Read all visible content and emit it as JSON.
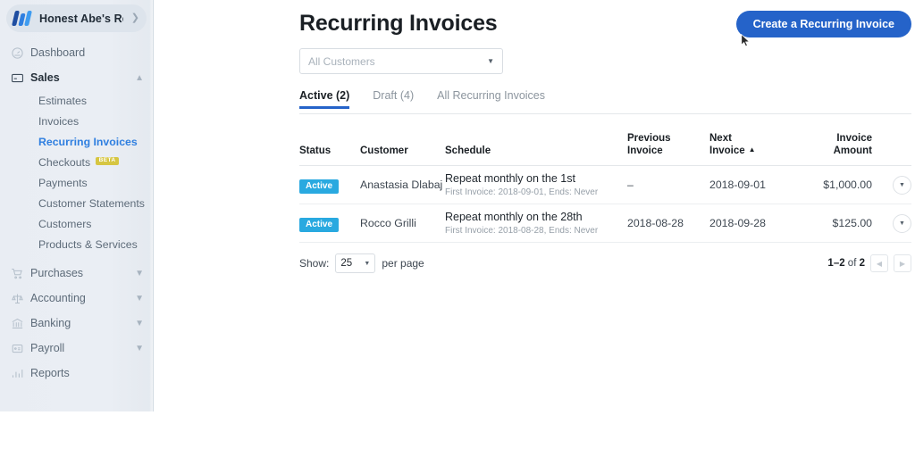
{
  "sidebar": {
    "business": {
      "name": "Honest Abe's Re…",
      "logo_icon": "wave-logo-icon",
      "chevron_icon": "chevron-right-icon"
    },
    "items": [
      {
        "label": "Dashboard",
        "icon": "gauge-icon",
        "expandable": false
      },
      {
        "label": "Sales",
        "icon": "credit-card-icon",
        "expandable": true,
        "expanded": true
      }
    ],
    "sales_subitems": [
      {
        "label": "Estimates",
        "active": false
      },
      {
        "label": "Invoices",
        "active": false
      },
      {
        "label": "Recurring Invoices",
        "active": true
      },
      {
        "label": "Checkouts",
        "active": false,
        "badge": "BETA"
      },
      {
        "label": "Payments",
        "active": false
      },
      {
        "label": "Customer Statements",
        "active": false
      },
      {
        "label": "Customers",
        "active": false
      },
      {
        "label": "Products & Services",
        "active": false
      }
    ],
    "lower_items": [
      {
        "label": "Purchases",
        "icon": "shopping-cart-icon",
        "expandable": true
      },
      {
        "label": "Accounting",
        "icon": "scales-icon",
        "expandable": true
      },
      {
        "label": "Banking",
        "icon": "bank-icon",
        "expandable": true
      },
      {
        "label": "Payroll",
        "icon": "payroll-card-icon",
        "expandable": true
      },
      {
        "label": "Reports",
        "icon": "bar-chart-icon",
        "expandable": false
      }
    ]
  },
  "header": {
    "title": "Recurring Invoices",
    "cta_label": "Create a Recurring Invoice",
    "cta_color": "#2563c9"
  },
  "filter": {
    "customer_placeholder": "All Customers",
    "customer_value": "",
    "chevron_icon": "chevron-down-icon"
  },
  "tabs": [
    {
      "label": "Active (2)",
      "selected": true
    },
    {
      "label": "Draft (4)",
      "selected": false
    },
    {
      "label": "All Recurring Invoices",
      "selected": false
    }
  ],
  "table": {
    "columns": {
      "status": "Status",
      "customer": "Customer",
      "schedule": "Schedule",
      "previous_invoice": "Previous\nInvoice",
      "previous_invoice_l1": "Previous",
      "previous_invoice_l2": "Invoice",
      "next_invoice_l1": "Next",
      "next_invoice_l2": "Invoice",
      "invoice_amount_l1": "Invoice",
      "invoice_amount_l2": "Amount"
    },
    "sort": {
      "column": "Next Invoice",
      "direction": "asc",
      "icon": "caret-up-icon"
    },
    "rows": [
      {
        "status": "Active",
        "status_color": "#29a9e0",
        "customer": "Anastasia Dlabaj",
        "schedule": "Repeat monthly on the 1st",
        "schedule_sub": "First Invoice: 2018-09-01, Ends: Never",
        "previous_invoice": "–",
        "next_invoice": "2018-09-01",
        "invoice_amount": "$1,000.00",
        "actions_icon": "caret-down-icon"
      },
      {
        "status": "Active",
        "status_color": "#29a9e0",
        "customer": "Rocco Grilli",
        "schedule": "Repeat monthly on the 28th",
        "schedule_sub": "First Invoice: 2018-08-28, Ends: Never",
        "previous_invoice": "2018-08-28",
        "next_invoice": "2018-09-28",
        "invoice_amount": "$125.00",
        "actions_icon": "caret-down-icon"
      }
    ]
  },
  "footer": {
    "show_label": "Show:",
    "per_page_value": "25",
    "per_page_label": "per page",
    "range_prefix": "1–2",
    "range_suffix": " of ",
    "range_total": "2",
    "prev_icon": "chevron-left-icon",
    "next_icon": "chevron-right-icon"
  }
}
